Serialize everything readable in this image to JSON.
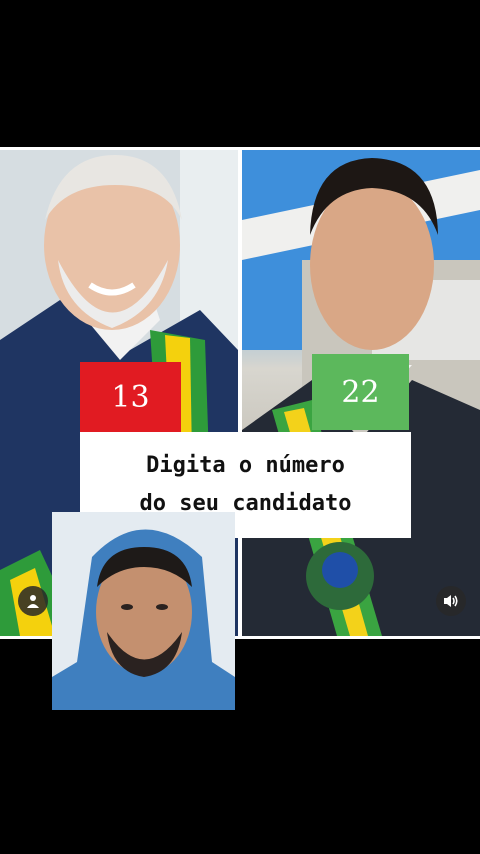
{
  "candidates": {
    "left_number": "13",
    "right_number": "22",
    "left_color": "#e11b22",
    "right_color": "#5cb85c"
  },
  "caption": {
    "line1": "Digita o número",
    "line2": "do seu candidato"
  },
  "icons": {
    "profile": "user-icon",
    "sound": "speaker-icon"
  }
}
